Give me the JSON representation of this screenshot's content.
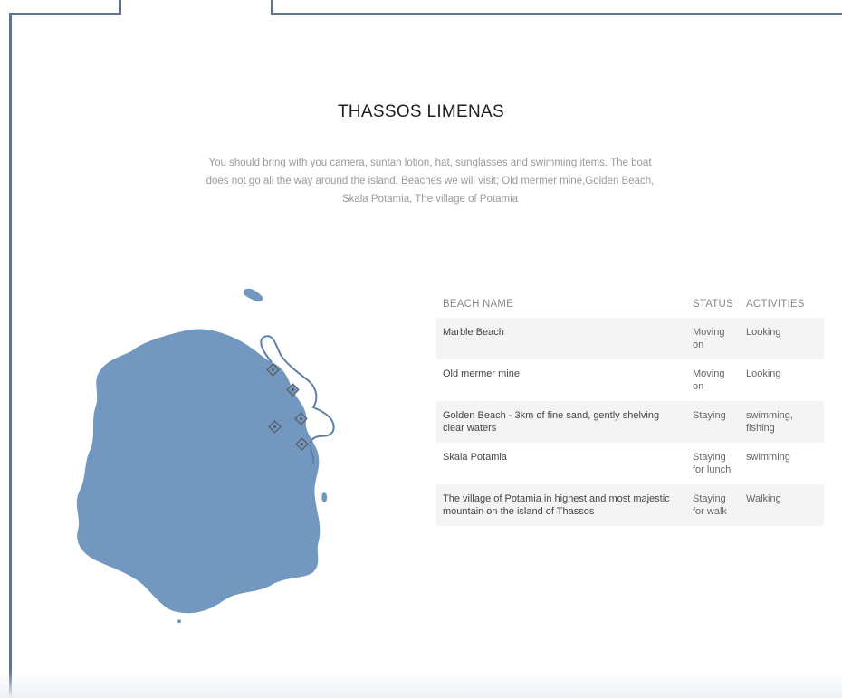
{
  "page": {
    "title": "THASSOS LIMENAS",
    "intro": "You should bring with you camera, suntan lotion, hat, sunglasses and swimming items. The boat does not go all the way around the island. Beaches we will visit; Old mermer mine,Golden Beach, Skala Potamia, The village of Potamia"
  },
  "map": {
    "fill_color": "#7398c0",
    "route_color": "#5e7fa8",
    "marker_icon": "diamond-marker-icon",
    "marker_count": 5
  },
  "table": {
    "headers": {
      "name": "BEACH NAME",
      "status": "STATUS",
      "activities": "ACTIVITIES"
    },
    "rows": [
      {
        "name": "Marble Beach",
        "status": "Moving on",
        "activities": "Looking"
      },
      {
        "name": "Old mermer mine",
        "status": "Moving on",
        "activities": "Looking"
      },
      {
        "name": "Golden Beach - 3km of fine sand, gently shelving clear waters",
        "status": "Staying",
        "activities": "swimming, fishing"
      },
      {
        "name": "Skala Potamia",
        "status": "Staying for lunch",
        "activities": "swimming"
      },
      {
        "name": "The village of Potamia in highest and most majestic mountain on the island of Thassos",
        "status": "Staying for walk",
        "activities": "Walking"
      }
    ]
  },
  "colors": {
    "frame": "#5f7391",
    "row_alt": "#f4f4f4"
  }
}
